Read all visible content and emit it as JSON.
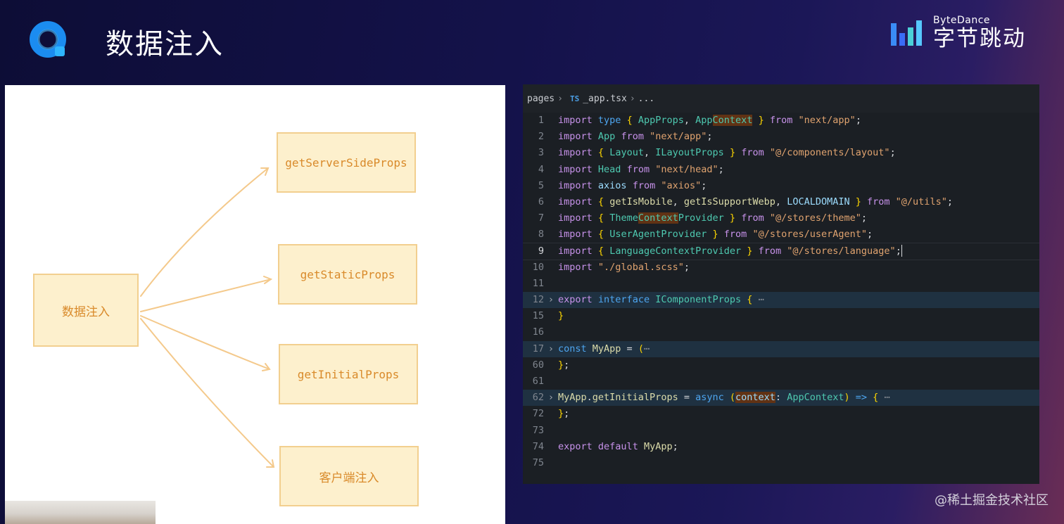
{
  "slide": {
    "title": "数据注入",
    "brand_en": "ByteDance",
    "brand_cn": "字节跳动",
    "credit": "@稀土掘金技术社区",
    "colors": {
      "accent": "#1b8cf0",
      "box_fill": "#fdf0cd",
      "box_stroke": "#f2cf8f",
      "box_text": "#d98a2a"
    }
  },
  "diagram": {
    "source": "数据注入",
    "targets": [
      "getServerSideProps",
      "getStaticProps",
      "getInitialProps",
      "客户端注入"
    ]
  },
  "editor": {
    "breadcrumb": {
      "folder": "pages",
      "lang_badge": "TS",
      "file": "_app.tsx",
      "ellipsis": "..."
    },
    "lines": [
      {
        "n": "1"
      },
      {
        "n": "2"
      },
      {
        "n": "3"
      },
      {
        "n": "4"
      },
      {
        "n": "5"
      },
      {
        "n": "6"
      },
      {
        "n": "7"
      },
      {
        "n": "8"
      },
      {
        "n": "9"
      },
      {
        "n": "10"
      },
      {
        "n": "11"
      },
      {
        "n": "12"
      },
      {
        "n": "15"
      },
      {
        "n": "16"
      },
      {
        "n": "17"
      },
      {
        "n": "60"
      },
      {
        "n": "61"
      },
      {
        "n": "62"
      },
      {
        "n": "72"
      },
      {
        "n": "73"
      },
      {
        "n": "74"
      },
      {
        "n": "75"
      }
    ],
    "tokens": {
      "import": "import",
      "type": "type",
      "from": "from",
      "export": "export",
      "interface": "interface",
      "const": "const",
      "async": "async",
      "default": "default",
      "AppProps": "AppProps",
      "AppPrefix": "App",
      "Context": "Context",
      "App": "App",
      "Layout": "Layout",
      "ILayoutProps": "ILayoutProps",
      "Head": "Head",
      "axios": "axios",
      "getIsMobile": "getIsMobile",
      "getIsSupportWebp": "getIsSupportWebp",
      "LOCALDOMAIN": "LOCALDOMAIN",
      "ThemePrefix": "Theme",
      "ProviderSuffix": "Provider",
      "UserAgentProvider": "UserAgentProvider",
      "LanguagePrefix": "Language",
      "IComponentProps": "IComponentProps",
      "MyApp": "MyApp",
      "getInitialProps": "getInitialProps",
      "context": "context",
      "AppContext": "AppContext",
      "s_next_app": "\"next/app\"",
      "s_layout": "\"@/components/layout\"",
      "s_next_head": "\"next/head\"",
      "s_axios": "\"axios\"",
      "s_utils": "\"@/utils\"",
      "s_theme": "\"@/stores/theme\"",
      "s_useragent": "\"@/stores/userAgent\"",
      "s_language": "\"@/stores/language\"",
      "s_global": "\"./global.scss\"",
      "ellipsis": "⋯"
    }
  }
}
